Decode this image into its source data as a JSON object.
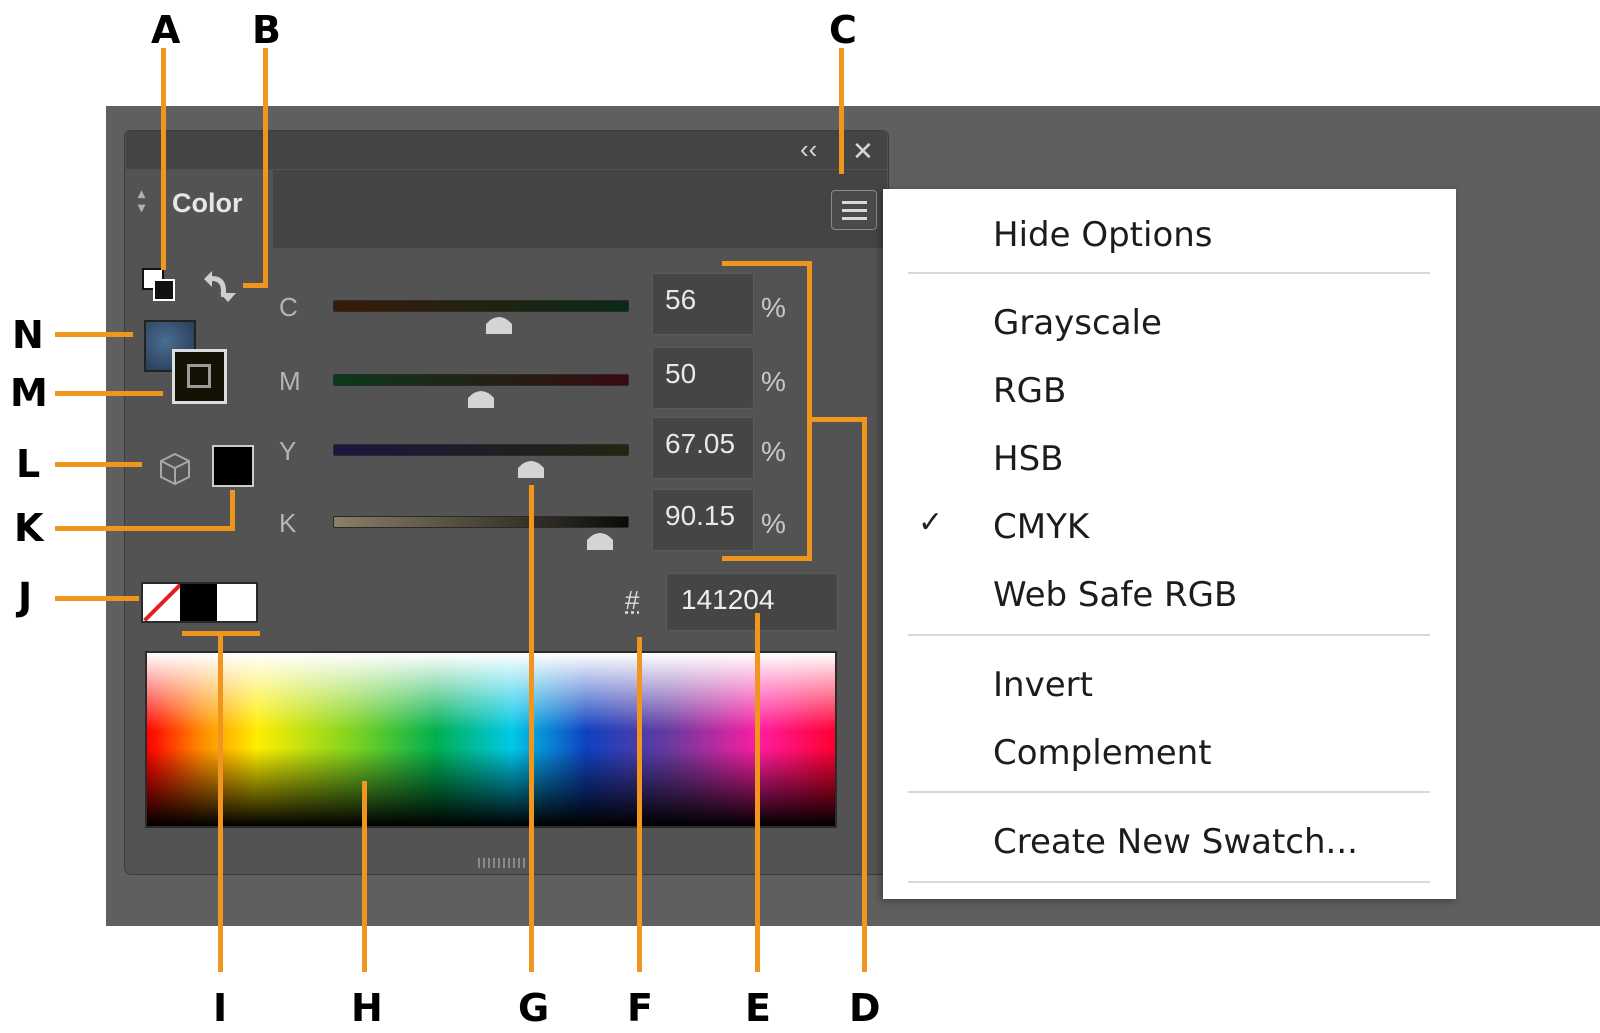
{
  "panel": {
    "collapse_icon": "‹‹",
    "close_icon": "✕",
    "tab_label": "Color",
    "menu_button_icon": "hamburger-icon"
  },
  "channels": [
    {
      "label": "C",
      "value": "56",
      "unit": "%",
      "level_percent": 56
    },
    {
      "label": "M",
      "value": "50",
      "unit": "%",
      "level_percent": 50
    },
    {
      "label": "Y",
      "value": "67.05",
      "unit": "%",
      "level_percent": 67.05
    },
    {
      "label": "K",
      "value": "90.15",
      "unit": "%",
      "level_percent": 90.15
    }
  ],
  "hex": {
    "symbol": "#",
    "value": "141204"
  },
  "colors": {
    "fill_swatch": "#2a4a6a",
    "stroke_swatch": "#141204",
    "last_color": "#000000",
    "accent_callout": "#f0961e"
  },
  "menu": {
    "items": [
      "Hide Options",
      "Grayscale",
      "RGB",
      "HSB",
      "CMYK",
      "Web Safe RGB",
      "Invert",
      "Complement",
      "Create New Swatch..."
    ],
    "checked": "CMYK"
  },
  "callouts": [
    "A",
    "B",
    "C",
    "D",
    "E",
    "F",
    "G",
    "H",
    "I",
    "J",
    "K",
    "L",
    "M",
    "N"
  ]
}
